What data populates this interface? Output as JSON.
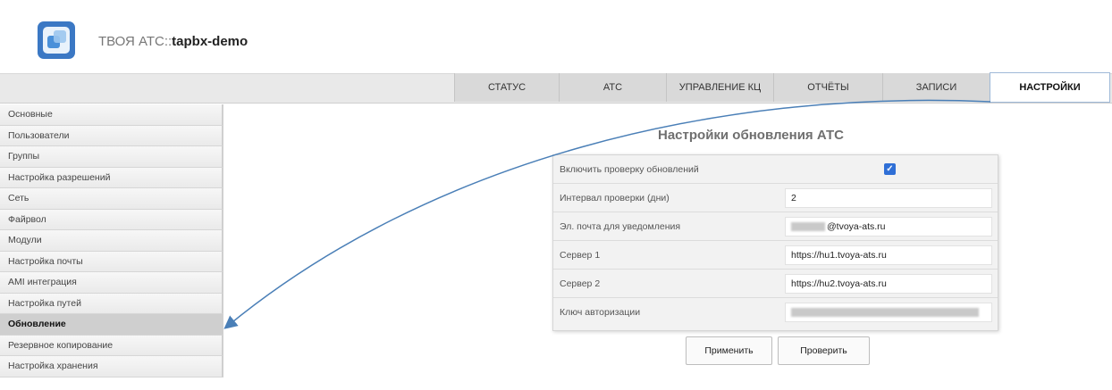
{
  "header": {
    "title_prefix": "ТВОЯ АТС::",
    "title_name": "tapbx-demo"
  },
  "nav": {
    "tabs": [
      "СТАТУС",
      "АТС",
      "УПРАВЛЕНИЕ КЦ",
      "ОТЧЁТЫ",
      "ЗАПИСИ",
      "НАСТРОЙКИ"
    ],
    "active": "НАСТРОЙКИ"
  },
  "sidebar": {
    "items": [
      "Основные",
      "Пользователи",
      "Группы",
      "Настройка разрешений",
      "Сеть",
      "Файрвол",
      "Модули",
      "Настройка почты",
      "AMI интеграция",
      "Настройка путей",
      "Обновление",
      "Резервное копирование",
      "Настройка хранения"
    ],
    "active": "Обновление"
  },
  "main": {
    "title": "Настройки обновления АТС",
    "fields": [
      {
        "label": "Включить проверку обновлений",
        "value": "",
        "checked": true
      },
      {
        "label": "Интервал проверки (дни)",
        "value": "2"
      },
      {
        "label": "Эл. почта для уведомления",
        "value": "@tvoya-ats.ru"
      },
      {
        "label": "Сервер 1",
        "value": "https://hu1.tvoya-ats.ru"
      },
      {
        "label": "Сервер 2",
        "value": "https://hu2.tvoya-ats.ru"
      },
      {
        "label": "Ключ авторизации",
        "value": ""
      }
    ],
    "buttons": {
      "apply": "Применить",
      "check": "Проверить"
    }
  },
  "colors": {
    "accent": "#2f6fd6",
    "arrow": "#4a7fb7",
    "active_tab_border": "#9fb9d8"
  }
}
